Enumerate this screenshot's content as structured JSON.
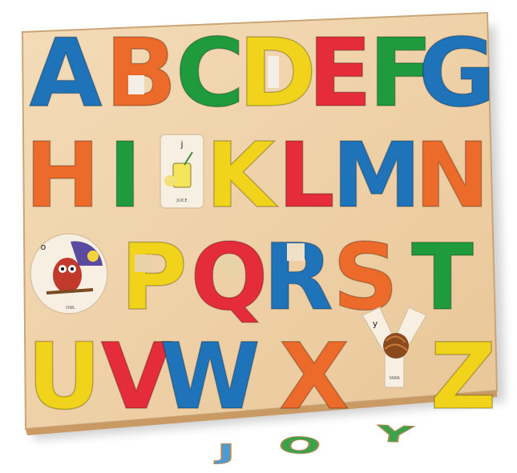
{
  "rows": [
    [
      "A",
      "B",
      "C",
      "D",
      "E",
      "F",
      "G"
    ],
    [
      "H",
      "I",
      "K",
      "L",
      "M",
      "N"
    ],
    [
      "P",
      "Q",
      "R",
      "S",
      "T"
    ],
    [
      "U",
      "V",
      "W",
      "X",
      "Z"
    ]
  ],
  "colors": {
    "A": "#1f73b8",
    "B": "#ec6a2a",
    "C": "#1f9a3d",
    "D": "#f2d31c",
    "E": "#e52c3a",
    "F": "#1f9a3d",
    "G": "#1f73b8",
    "H": "#ec6a2a",
    "I": "#1f9a3d",
    "K": "#f2d31c",
    "L": "#e52c3a",
    "M": "#1f73b8",
    "N": "#ec6a2a",
    "P": "#f2d31c",
    "Q": "#e52c3a",
    "R": "#1f73b8",
    "S": "#ec6a2a",
    "T": "#1f9a3d",
    "U": "#f2d31c",
    "V": "#e52c3a",
    "W": "#1f73b8",
    "X": "#ec6a2a",
    "Z": "#f2d31c"
  },
  "empty_slots": [
    {
      "letter": "j",
      "caption": "JUICE"
    },
    {
      "letter": "o",
      "caption": "OWL"
    },
    {
      "letter": "y",
      "caption": "YARN"
    }
  ],
  "loose_pieces": [
    {
      "letter": "J",
      "color": "#4a9bd6"
    },
    {
      "letter": "O",
      "color": "#3aa34a"
    },
    {
      "letter": "Y",
      "color": "#3aa34a"
    }
  ],
  "board_color": "#efd3ad"
}
